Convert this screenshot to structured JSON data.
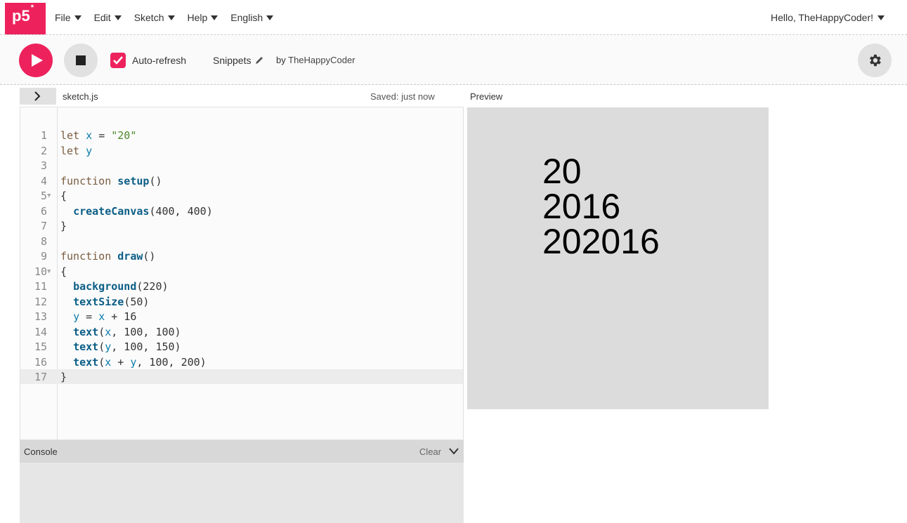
{
  "nav": {
    "logo": "p5",
    "logo_star": "*",
    "menu": [
      "File",
      "Edit",
      "Sketch",
      "Help",
      "English"
    ],
    "user_greeting": "Hello, TheHappyCoder!"
  },
  "toolbar": {
    "play_icon": "play-icon",
    "stop_icon": "stop-icon",
    "autorefresh_checked": true,
    "autorefresh_label": "Auto-refresh",
    "sketch_name": "Snippets",
    "by_prefix": "by",
    "owner": "TheHappyCoder",
    "settings_icon": "gear-icon"
  },
  "editor": {
    "file_name": "sketch.js",
    "saved_status": "Saved: just now",
    "active_line": 17,
    "lines": [
      {
        "n": "1",
        "code": "let x = \"20\""
      },
      {
        "n": "2",
        "code": "let y"
      },
      {
        "n": "3",
        "code": ""
      },
      {
        "n": "4",
        "code": "function setup()"
      },
      {
        "n": "5",
        "code": "{",
        "fold": true
      },
      {
        "n": "6",
        "code": "  createCanvas(400, 400)"
      },
      {
        "n": "7",
        "code": "}"
      },
      {
        "n": "8",
        "code": ""
      },
      {
        "n": "9",
        "code": "function draw()"
      },
      {
        "n": "10",
        "code": "{",
        "fold": true
      },
      {
        "n": "11",
        "code": "  background(220)"
      },
      {
        "n": "12",
        "code": "  textSize(50)"
      },
      {
        "n": "13",
        "code": "  y = x + 16"
      },
      {
        "n": "14",
        "code": "  text(x, 100, 100)"
      },
      {
        "n": "15",
        "code": "  text(y, 100, 150)"
      },
      {
        "n": "16",
        "code": "  text(x + y, 100, 200)"
      },
      {
        "n": "17",
        "code": "}"
      }
    ]
  },
  "preview": {
    "label": "Preview",
    "outputs": [
      "20",
      "2016",
      "202016"
    ]
  },
  "console": {
    "title": "Console",
    "clear_label": "Clear"
  },
  "colors": {
    "accent": "#ed225d",
    "canvas_bg": "#dcdcdc"
  }
}
